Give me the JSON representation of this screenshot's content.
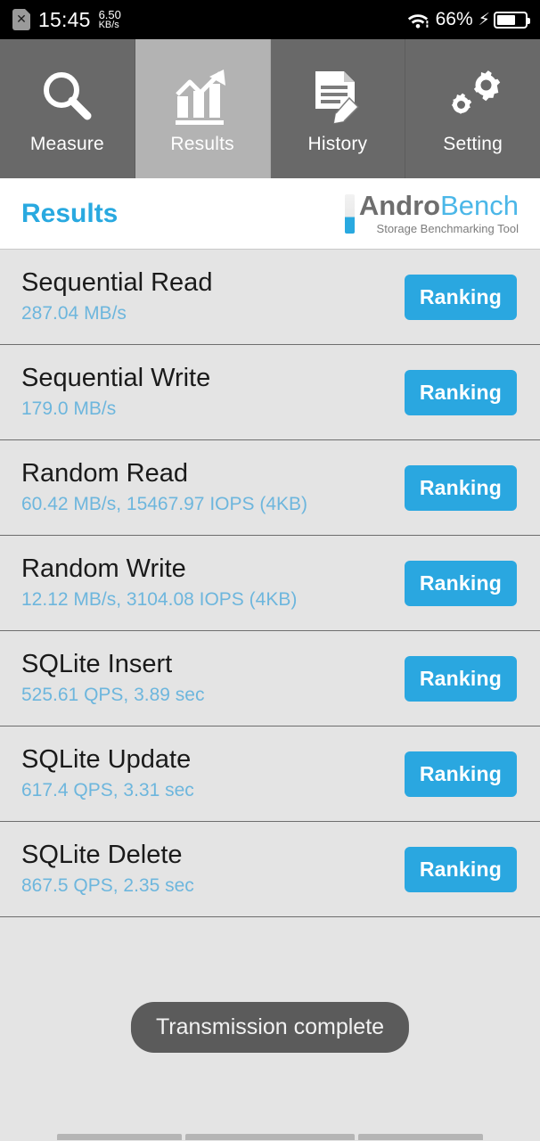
{
  "statusbar": {
    "sim_icon": "sim-card-disabled-icon",
    "sim_glyph": "✕",
    "time": "15:45",
    "net_speed_value": "6.50",
    "net_speed_unit": "KB/s",
    "wifi_icon": "wifi-icon",
    "battery_percent": "66%",
    "charging_glyph": "⚡",
    "battery_level": 66
  },
  "tabs": [
    {
      "label": "Measure",
      "icon": "magnifier-icon",
      "selected": false
    },
    {
      "label": "Results",
      "icon": "bar-chart-arrow-icon",
      "selected": true
    },
    {
      "label": "History",
      "icon": "document-pencil-icon",
      "selected": false
    },
    {
      "label": "Setting",
      "icon": "gears-icon",
      "selected": false
    }
  ],
  "header": {
    "title": "Results",
    "logo_name_primary": "Andro",
    "logo_name_secondary": "Bench",
    "logo_tagline": "Storage Benchmarking Tool"
  },
  "results": [
    {
      "name": "Sequential Read",
      "value": "287.04 MB/s",
      "button": "Ranking"
    },
    {
      "name": "Sequential Write",
      "value": "179.0 MB/s",
      "button": "Ranking"
    },
    {
      "name": "Random Read",
      "value": "60.42 MB/s, 15467.97 IOPS (4KB)",
      "button": "Ranking"
    },
    {
      "name": "Random Write",
      "value": "12.12 MB/s, 3104.08 IOPS (4KB)",
      "button": "Ranking"
    },
    {
      "name": "SQLite Insert",
      "value": "525.61 QPS, 3.89 sec",
      "button": "Ranking"
    },
    {
      "name": "SQLite Update",
      "value": "617.4 QPS, 3.31 sec",
      "button": "Ranking"
    },
    {
      "name": "SQLite Delete",
      "value": "867.5 QPS, 2.35 sec",
      "button": "Ranking"
    }
  ],
  "toast": {
    "message": "Transmission complete"
  },
  "colors": {
    "accent_blue": "#2aa7e0",
    "value_blue": "#6db6dd",
    "tab_unselected": "#696969",
    "tab_selected": "#b3b3b3",
    "list_background": "#e4e4e4",
    "toast_background": "#5b5b5b"
  }
}
